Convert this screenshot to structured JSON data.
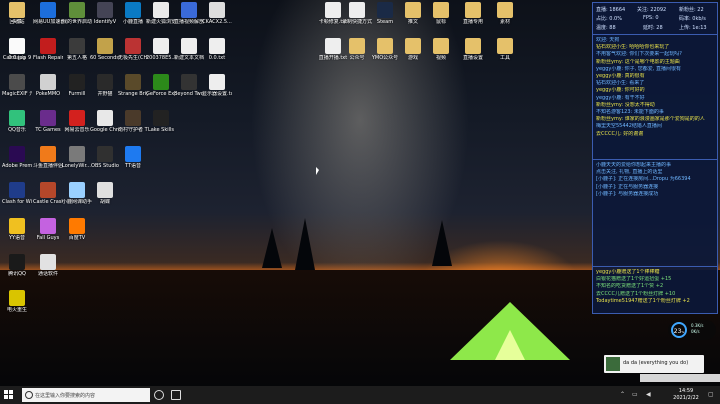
{
  "stats": {
    "live_id": "直播: 18664",
    "audience": "关注: 22092",
    "gifts": "新粉丝: 22",
    "bitrate": "占比: 0.0%",
    "fps": "FPS: 0",
    "speed": "码率: 0kb/s",
    "temp": "温度: 88",
    "ping": "延时: 28",
    "upload": "上传: 1e:13"
  },
  "chat_lines": [
    {
      "text": "欢迎: 天狗",
      "color": "b"
    },
    {
      "text": "钻石欢迎小生: 哈哈哈你也来玩了",
      "color": "y"
    },
    {
      "text": "不用客气欢迎: 你们下次要来一起玩吗?",
      "color": "b"
    },
    {
      "text": "新粉丝ymy: 这个是哪个电影的主题曲",
      "color": "y"
    },
    {
      "text": "yeggy小鹿: 你子, 您都爱, 直播间很有",
      "color": "b"
    },
    {
      "text": "yeggy小鹿: 真的很有",
      "color": "y"
    },
    {
      "text": "钻石欢迎小生: 看来了",
      "color": "b"
    },
    {
      "text": "yeggy小鹿: 你可好的",
      "color": "y"
    },
    {
      "text": "yeggy小鹿: 有干不好",
      "color": "b"
    },
    {
      "text": "新粉丝ymy: 没想太不得动",
      "color": "y"
    },
    {
      "text": "不知名游客123: 未能下面的事",
      "color": "b"
    },
    {
      "text": "新粉丝ymy: 谁家的浪漫画家是那个爱狗是的的人",
      "color": "y"
    },
    {
      "text": "梅里天空55442结婚人直播间",
      "color": "b"
    },
    {
      "text": "去CCCC儿: 好的谢谢",
      "color": "y"
    }
  ],
  "event_lines": [
    {
      "text": "小鹿天天的爱给你想起来主播的事",
      "color": "b"
    },
    {
      "text": "点击关注, 礼物, 直播上的话里",
      "color": "b"
    },
    {
      "text": "[小鹿子]: 正在连接房间...Dropu 为66394",
      "color": "b"
    },
    {
      "text": "[小鹿子]: 正在与服务器连接",
      "color": "b"
    },
    {
      "text": "[小鹿子]: 与服务器连接成功",
      "color": "b"
    }
  ],
  "gift_lines": [
    {
      "text": "yeggy小鹿赠送了1个棒棒糖",
      "color": "y"
    },
    {
      "text": "白银花猫赠送了1个好运扭蛋 +15",
      "color": "g"
    },
    {
      "text": "不知名的吃货赠送了1个赞 +2",
      "color": "g"
    },
    {
      "text": "去CCCC儿赠送了1个粉丝灯牌 +10",
      "color": "g"
    },
    {
      "text": "Todaytime51947赠送了1个粉丝灯牌 +2",
      "color": "y"
    }
  ],
  "gauge": {
    "value": "23",
    "unit": "%",
    "line1": "0.3K/s",
    "line2": "0K/s"
  },
  "music": {
    "title": "da da (everything you do)"
  },
  "taskbar": {
    "search_placeholder": "在这里输入你要搜索的内容",
    "time": "14:59",
    "date": "2021/2/22"
  },
  "desktop_icons": [
    {
      "label": "回收站",
      "color": "#9aa5b8"
    },
    {
      "label": "Camtasia 9",
      "color": "#2eaa3a"
    },
    {
      "label": "MagicEXIF 元数据编辑器",
      "color": "#4b4b4b"
    },
    {
      "label": "QQ音乐",
      "color": "#31c27c"
    },
    {
      "label": "Adobe Premie...",
      "color": "#2a0a52"
    },
    {
      "label": "Clash for Windows",
      "color": "#1f3c8a"
    },
    {
      "label": "YY语音",
      "color": "#f0c020"
    },
    {
      "label": "腾讯QQ",
      "color": "#1a1a1a"
    },
    {
      "label": "电火重生",
      "color": "#d9c400"
    },
    {
      "label": "网易UU加速器",
      "color": "#1c6edc"
    },
    {
      "label": "Flash Repair",
      "color": "#c21d1d"
    },
    {
      "label": "PokeMMO",
      "color": "#d1d1d1"
    },
    {
      "label": "TC Games",
      "color": "#6a2c8c"
    },
    {
      "label": "斗鱼直播伴侣",
      "color": "#f07a1a"
    },
    {
      "label": "Castle Crashers",
      "color": "#b5472a"
    },
    {
      "label": "Fall Guys",
      "color": "#c462e0"
    },
    {
      "label": "通话软件",
      "color": "#e2e2e2"
    },
    {
      "label": "我的世界启动器",
      "color": "#5f8f3a"
    },
    {
      "label": "第五人格",
      "color": "#3b3b3b"
    },
    {
      "label": "Furmill",
      "color": "#222"
    },
    {
      "label": "网易云音乐",
      "color": "#d3211e"
    },
    {
      "label": "LonelyWir... 快捷方式",
      "color": "#7a7a7a"
    },
    {
      "label": "小鹿网课助手",
      "color": "#9ad0ff"
    },
    {
      "label": "百度TV",
      "color": "#ff7a00"
    },
    {
      "label": "IdentifyV",
      "color": "#445"
    },
    {
      "label": "60 Seconds! Reatomized",
      "color": "#c2a24a"
    },
    {
      "label": "井野猫",
      "color": "#2a2a2a"
    },
    {
      "label": "Google Chrome",
      "color": "#e8e8e8"
    },
    {
      "label": "OBS Studio",
      "color": "#303030"
    },
    {
      "label": "胡蝶",
      "color": "#e0e0e0"
    },
    {
      "label": "小鹿直播",
      "color": "#0a7ac4"
    },
    {
      "label": "无极先生(CHUCHEL)",
      "color": "#b33"
    },
    {
      "label": "Strange Brigade",
      "color": "#5a4a2a"
    },
    {
      "label": "南村守护者 The Invisib...",
      "color": "#4a3a2a"
    },
    {
      "label": "TT语音",
      "color": "#1e7af0"
    },
    {
      "label": "新建火狐浏览器 Online(F...",
      "color": "#eaeaea"
    },
    {
      "label": "200378E5...",
      "color": "#eee"
    },
    {
      "label": "GeForce Experience",
      "color": "#2c8a1a"
    },
    {
      "label": "Lake Skills",
      "color": "#222"
    },
    {
      "label": "直播视频解剖软件",
      "color": "#3a6ad8"
    },
    {
      "label": "新建文本文档.txt",
      "color": "#eee"
    },
    {
      "label": "Beyond Two Souls",
      "color": "#333"
    },
    {
      "label": "CKACX2.5...",
      "color": "#ddd"
    },
    {
      "label": "0.0.txt",
      "color": "#eee"
    },
    {
      "label": "显示器设置.txt",
      "color": "#eee"
    },
    {
      "label": "卡顿修复.txt",
      "color": "#eee"
    },
    {
      "label": "直播开播.txt",
      "color": "#eee"
    },
    {
      "label": "录制快捷方式.txt",
      "color": "#eee"
    },
    {
      "label": "公众号",
      "color": "#e5c16a"
    },
    {
      "label": "Steam",
      "color": "#1a2a46"
    },
    {
      "label": "YMO公众号",
      "color": "#e5c16a"
    },
    {
      "label": "推文",
      "color": "#e5c16a"
    },
    {
      "label": "游戏",
      "color": "#e5c16a"
    },
    {
      "label": "鼠标",
      "color": "#e5c16a"
    },
    {
      "label": "视频",
      "color": "#e5c16a"
    },
    {
      "label": "直播专用",
      "color": "#e5c16a"
    },
    {
      "label": "直播设置",
      "color": "#e5c16a"
    },
    {
      "label": "素材",
      "color": "#e5c16a"
    },
    {
      "label": "工具",
      "color": "#e5c16a"
    },
    {
      "label": "头像",
      "color": "#e5c16a"
    },
    {
      "label": "0.0.jpg",
      "color": "#fafafa"
    }
  ]
}
